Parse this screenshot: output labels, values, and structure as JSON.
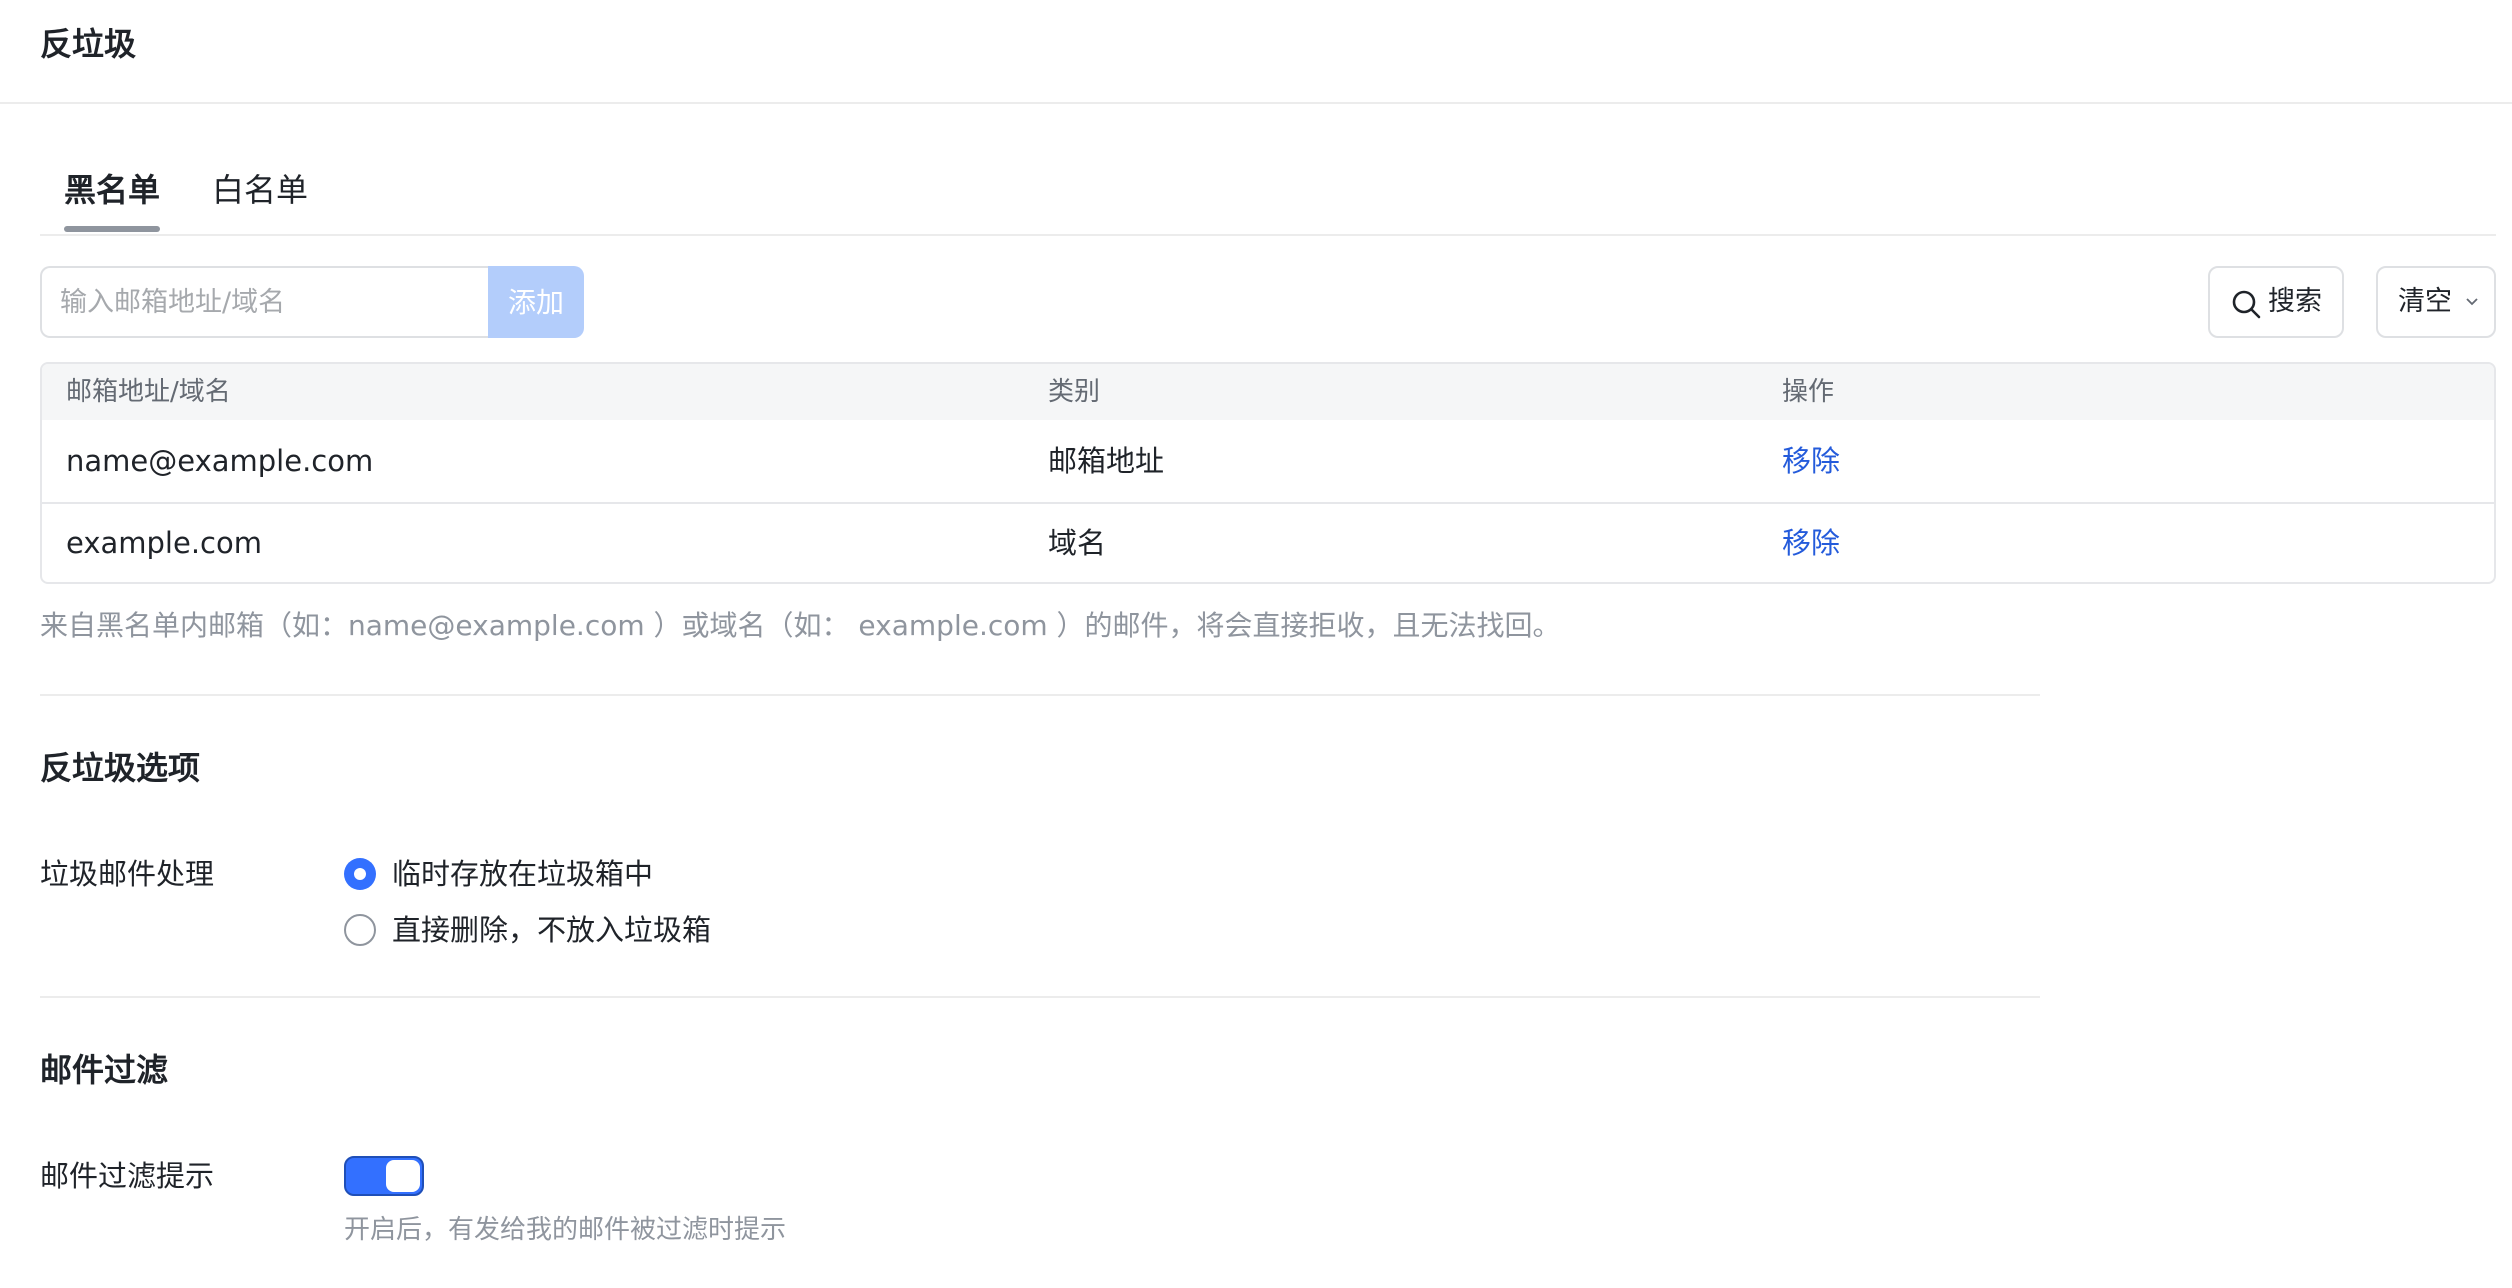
{
  "page": {
    "title": "反垃圾"
  },
  "tabs": [
    {
      "label": "黑名单",
      "active": true
    },
    {
      "label": "白名单",
      "active": false
    }
  ],
  "toolbar": {
    "input_placeholder": "输入邮箱地址/域名",
    "input_value": "",
    "add_label": "添加",
    "search_label": "搜索",
    "clear_label": "清空",
    "search_icon": "search-icon",
    "clear_dropdown_icon": "chevron-down-icon"
  },
  "table": {
    "columns": [
      "邮箱地址/域名",
      "类别",
      "操作"
    ],
    "rows": [
      {
        "address": "name@example.com",
        "type": "邮箱地址",
        "action": "移除"
      },
      {
        "address": "example.com",
        "type": "域名",
        "action": "移除"
      }
    ]
  },
  "blacklist_hint": "来自黑名单内邮箱（如：name@example.com ）或域名（如： example.com ）的邮件，将会直接拒收，且无法找回。",
  "antispam_options": {
    "title": "反垃圾选项",
    "field_label": "垃圾邮件处理",
    "options": [
      {
        "label": "临时存放在垃圾箱中",
        "checked": true
      },
      {
        "label": "直接删除，不放入垃圾箱",
        "checked": false
      }
    ]
  },
  "mail_filter": {
    "title": "邮件过滤",
    "field_label": "邮件过滤提示",
    "toggle_on": true,
    "hint": "开启后，有发给我的邮件被过滤时提示"
  },
  "colors": {
    "accent": "#3370ff",
    "link": "#245bdb",
    "add_button_disabled": "#b3cdfb",
    "muted_text": "#8f959e"
  }
}
